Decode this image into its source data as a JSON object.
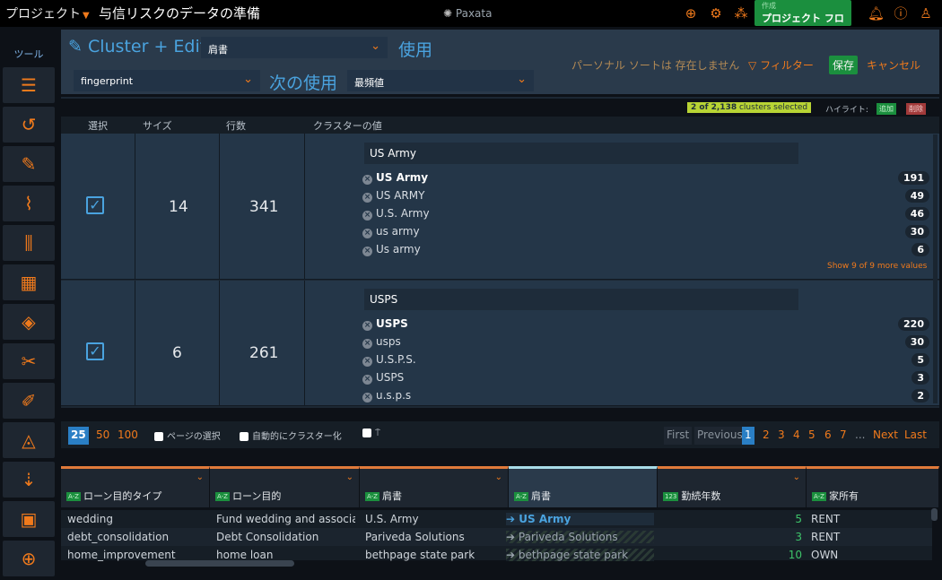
{
  "topbar": {
    "project": "プロジェクト",
    "title": "与信リスクのデータの準備",
    "logo": "Paxata",
    "flow_small": "作成",
    "flow_big": "プロジェクト フロー"
  },
  "sidebar": {
    "head": "ツール",
    "icons": [
      "filter-lines-icon",
      "history-icon",
      "pencil-icon",
      "paperclip-icon",
      "columns-icon",
      "calculator-icon",
      "diamond-tool-icon",
      "scissors-icon",
      "brush-icon",
      "shapes-icon",
      "sort-numeric-icon",
      "monitor-robot-icon",
      "add-shape-icon"
    ]
  },
  "cluster": {
    "title": "Cluster + Edit",
    "column_select": "肩書",
    "use_label": "使用",
    "algo_select": "fingerprint",
    "next_use_label": "次の使用",
    "next_select": "最頻値",
    "notice": "パーソナル ソートは 存在しません",
    "filter": "フィルター",
    "save": "保存",
    "cancel": "キャンセル"
  },
  "info": {
    "selected_count": "2 of 2,138",
    "selected_suffix": "clusters selected",
    "highlight": "ハイライト:",
    "add": "追加",
    "remove": "削除"
  },
  "headers": {
    "select": "選択",
    "size": "サイズ",
    "rows": "行数",
    "values": "クラスターの値"
  },
  "clusters": [
    {
      "size": "14",
      "rows": "341",
      "value": "US Army",
      "items": [
        {
          "v": "US Army",
          "c": "191"
        },
        {
          "v": "US ARMY",
          "c": "49"
        },
        {
          "v": "U.S. Army",
          "c": "46"
        },
        {
          "v": "us army",
          "c": "30"
        },
        {
          "v": "Us army",
          "c": "6"
        }
      ],
      "more": "Show 9 of 9 more values"
    },
    {
      "size": "6",
      "rows": "261",
      "value": "USPS",
      "items": [
        {
          "v": "USPS",
          "c": "220"
        },
        {
          "v": "usps",
          "c": "30"
        },
        {
          "v": "U.S.P.S.",
          "c": "5"
        },
        {
          "v": "USPS",
          "c": "3"
        },
        {
          "v": "u.s.p.s",
          "c": "2"
        }
      ]
    }
  ],
  "pager": {
    "sizes": [
      "25",
      "50",
      "100"
    ],
    "select_page": "ページの選択",
    "auto_cluster": "自動的にクラスター化",
    "first": "First",
    "previous": "Previous",
    "pages": [
      "1",
      "2",
      "3",
      "4",
      "5",
      "6",
      "7",
      "..."
    ],
    "next": "Next",
    "last": "Last"
  },
  "table": {
    "columns": [
      {
        "tag": "A-Z",
        "name": "ローン目的タイプ"
      },
      {
        "tag": "A-Z",
        "name": "ローン目的"
      },
      {
        "tag": "A-Z",
        "name": "肩書"
      },
      {
        "tag": "A-Z",
        "name": "肩書"
      },
      {
        "tag": "123",
        "name": "勤続年数"
      },
      {
        "tag": "A-Z",
        "name": "家所有"
      }
    ],
    "rows": [
      [
        "wedding",
        "Fund wedding and associa...",
        "U.S. Army",
        "US Army",
        "5",
        "RENT"
      ],
      [
        "debt_consolidation",
        "Debt Consolidation",
        "Pariveda Solutions",
        "Pariveda Solutions",
        "3",
        "RENT"
      ],
      [
        "home_improvement",
        "home loan",
        "bethpage state park",
        "bethpage state park",
        "10",
        "OWN"
      ]
    ]
  },
  "colors": {
    "accent": "#f07a1c",
    "blue": "#4aa3df",
    "green": "#1b8f3e",
    "panel": "#2a3a4b"
  }
}
